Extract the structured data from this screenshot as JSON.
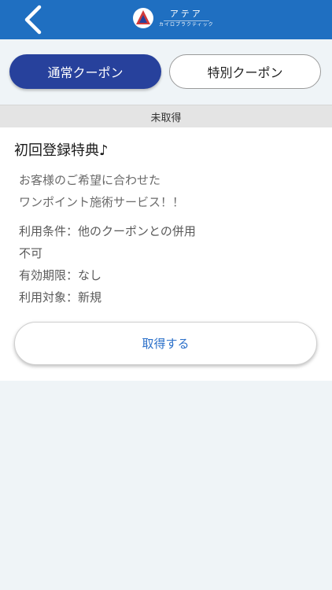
{
  "header": {
    "logo_title": "アテア",
    "logo_subtitle": "カイロプラクティック",
    "back_icon": "chevron-left-icon"
  },
  "tabs": [
    {
      "label": "通常クーポン",
      "active": true
    },
    {
      "label": "特別クーポン",
      "active": false
    }
  ],
  "status": "未取得",
  "coupon": {
    "title": "初回登録特典♪",
    "description": [
      "お客様のご希望に合わせた",
      "ワンポイント施術サービス！！"
    ],
    "conditions": [
      "利用条件：他のクーポンとの併用",
      "不可",
      "有効期限：なし",
      "利用対象：新規"
    ],
    "action_label": "取得する"
  },
  "colors": {
    "header": "#1f6fc1",
    "active_tab": "#27419c",
    "action_text": "#2a6fc9",
    "background": "#eff4f7"
  }
}
